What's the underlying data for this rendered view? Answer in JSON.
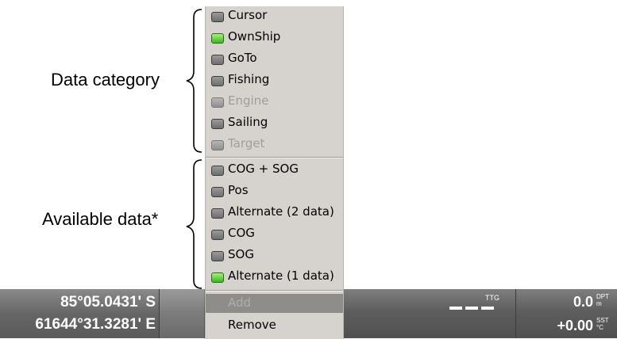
{
  "annotations": {
    "data_category": "Data category",
    "available_data": "Available data*"
  },
  "menu": {
    "categories": [
      {
        "label": "Cursor",
        "state": "off"
      },
      {
        "label": "OwnShip",
        "state": "on"
      },
      {
        "label": "GoTo",
        "state": "off"
      },
      {
        "label": "Fishing",
        "state": "off"
      },
      {
        "label": "Engine",
        "state": "disabled"
      },
      {
        "label": "Sailing",
        "state": "off"
      },
      {
        "label": "Target",
        "state": "disabled"
      }
    ],
    "data": [
      {
        "label": "COG + SOG",
        "state": "off"
      },
      {
        "label": "Pos",
        "state": "off"
      },
      {
        "label": "Alternate (2 data)",
        "state": "off"
      },
      {
        "label": "COG",
        "state": "off"
      },
      {
        "label": "SOG",
        "state": "off"
      },
      {
        "label": "Alternate (1 data)",
        "state": "on"
      }
    ],
    "add_label": "Add",
    "remove_label": "Remove"
  },
  "statusbar": {
    "lat": "85°05.0431' S",
    "lon": "61644°31.3281' E",
    "ttg_label": "TTG",
    "depth_value": "0.0",
    "depth_label": "DPT",
    "depth_unit": "m",
    "sst_value": "+0.00",
    "sst_label": "SST",
    "sst_unit": "°C"
  },
  "colors": {
    "led_on": "#3bb626",
    "led_off": "#6e6e6e",
    "menu_bg": "#d6d3ce",
    "status_bg": "#5d5d5d"
  }
}
